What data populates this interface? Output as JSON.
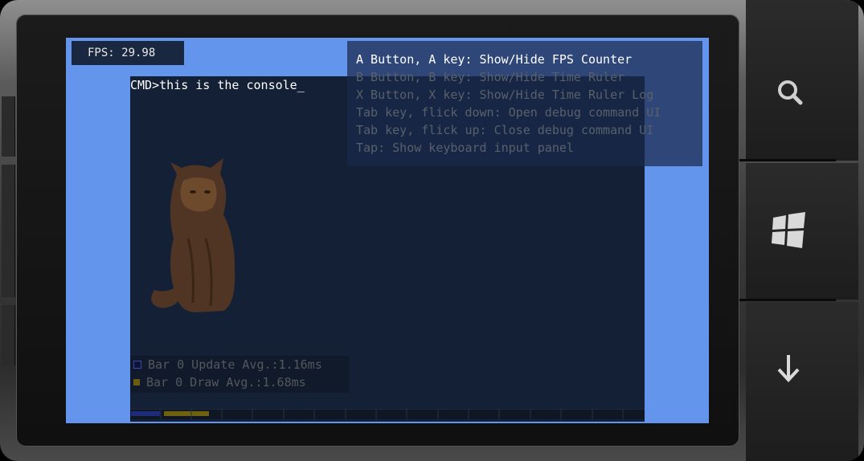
{
  "fps_counter": {
    "label": "FPS: 29.98"
  },
  "console": {
    "prompt": "CMD>this is the console_"
  },
  "help": {
    "lines": [
      "A Button, A key: Show/Hide FPS Counter",
      "B Button, B key: Show/Hide Time Ruler",
      "X Button, X key: Show/Hide Time Ruler Log",
      "Tab key, flick down: Open debug command UI",
      "Tab key, flick up: Close debug command UI",
      "Tap: Show keyboard input panel"
    ]
  },
  "time_ruler_log": {
    "rows": [
      {
        "label": "Bar 0 Update Avg.:1.16ms",
        "color": "#1f2a90"
      },
      {
        "label": "Bar 0 Draw Avg.:1.68ms",
        "color": "#7a6a12"
      }
    ]
  },
  "hardware_buttons": [
    "search-icon",
    "windows-logo-icon",
    "back-arrow-icon"
  ],
  "colors": {
    "background": "#6495ed",
    "console_bg": "#142036",
    "help_active_text": "#ffffff",
    "help_dim_text": "#59606a"
  }
}
